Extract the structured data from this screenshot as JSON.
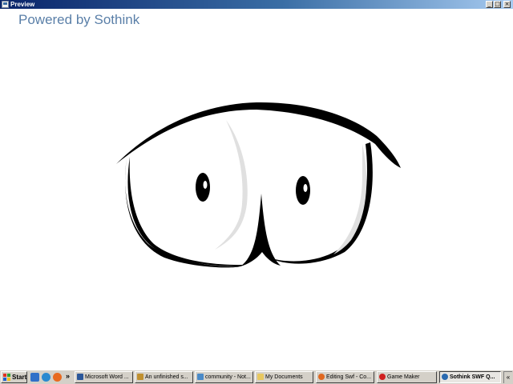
{
  "window": {
    "title": "Preview",
    "buttons": {
      "minimize": "_",
      "maximize": "□",
      "close": "×"
    }
  },
  "content": {
    "watermark": "Powered by Sothink"
  },
  "taskbar": {
    "start_label": "Start",
    "quicklaunch_more": "»",
    "tasks": [
      {
        "label": "Microsoft Word ...",
        "icon": "word-icon",
        "color": "#2b579a"
      },
      {
        "label": "An unfinished s...",
        "icon": "game-maker-icon",
        "color": "#c09030"
      },
      {
        "label": "community - Not...",
        "icon": "notepad-icon",
        "color": "#4a8ac8"
      },
      {
        "label": "My Documents",
        "icon": "folder-icon",
        "color": "#e8c860"
      },
      {
        "label": "Editing Swf - Co...",
        "icon": "firefox-icon",
        "color": "#e06820"
      },
      {
        "label": "Game Maker",
        "icon": "game-maker-red-icon",
        "color": "#d02020"
      },
      {
        "label": "Sothink SWF Q...",
        "icon": "sothink-icon",
        "color": "#2a6ab0"
      }
    ],
    "tray_arrow": "«"
  },
  "colors": {
    "titlebar_start": "#0a246a",
    "titlebar_end": "#a6caf0",
    "watermark": "#5a7fa8",
    "taskbar": "#d4d0c8"
  }
}
